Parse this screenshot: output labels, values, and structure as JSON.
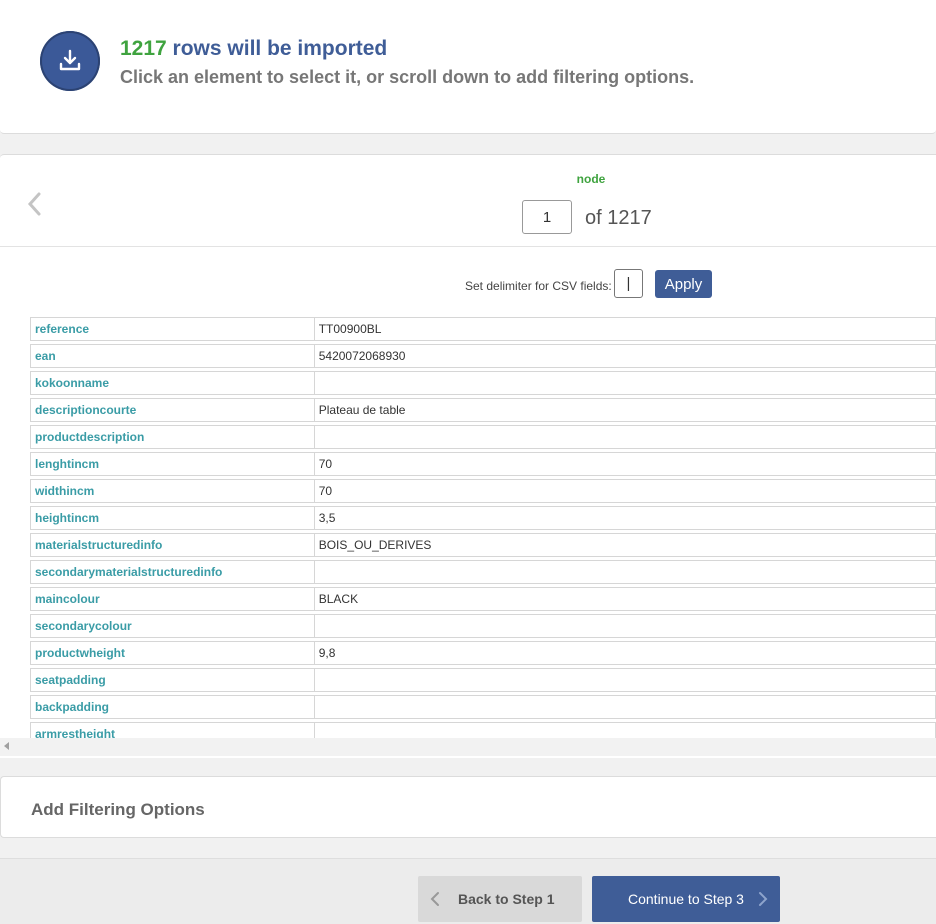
{
  "header": {
    "icon": "download-tray-icon",
    "row_count": "1217",
    "title_rest": " rows will be imported",
    "subtitle": "Click an element to select it, or scroll down to add filtering options."
  },
  "navigator": {
    "node_label": "node",
    "current_page": "1",
    "of_text": "of 1217",
    "prev_icon": "chevron-left-icon"
  },
  "delimiter": {
    "label": "Set delimiter for CSV fields:",
    "value": "|",
    "apply_label": "Apply"
  },
  "fields": [
    {
      "key": "reference",
      "value": "TT00900BL"
    },
    {
      "key": "ean",
      "value": "5420072068930"
    },
    {
      "key": "kokoonname",
      "value": ""
    },
    {
      "key": "descriptioncourte",
      "value": "Plateau de table"
    },
    {
      "key": "productdescription",
      "value": ""
    },
    {
      "key": "lenghtincm",
      "value": "70"
    },
    {
      "key": "widthincm",
      "value": "70"
    },
    {
      "key": "heightincm",
      "value": "3,5"
    },
    {
      "key": "materialstructuredinfo",
      "value": "BOIS_OU_DERIVES"
    },
    {
      "key": "secondarymaterialstructuredinfo",
      "value": ""
    },
    {
      "key": "maincolour",
      "value": "BLACK"
    },
    {
      "key": "secondarycolour",
      "value": ""
    },
    {
      "key": "productwheight",
      "value": "9,8"
    },
    {
      "key": "seatpadding",
      "value": ""
    },
    {
      "key": "backpadding",
      "value": ""
    },
    {
      "key": "armrestheight",
      "value": ""
    }
  ],
  "filter": {
    "title": "Add Filtering Options"
  },
  "footer": {
    "back_label": "Back to Step 1",
    "next_label": "Continue to Step 3"
  },
  "colors": {
    "primary": "#3f5d97",
    "accent_green": "#3fa33f",
    "key_text": "#3a9ca6"
  }
}
